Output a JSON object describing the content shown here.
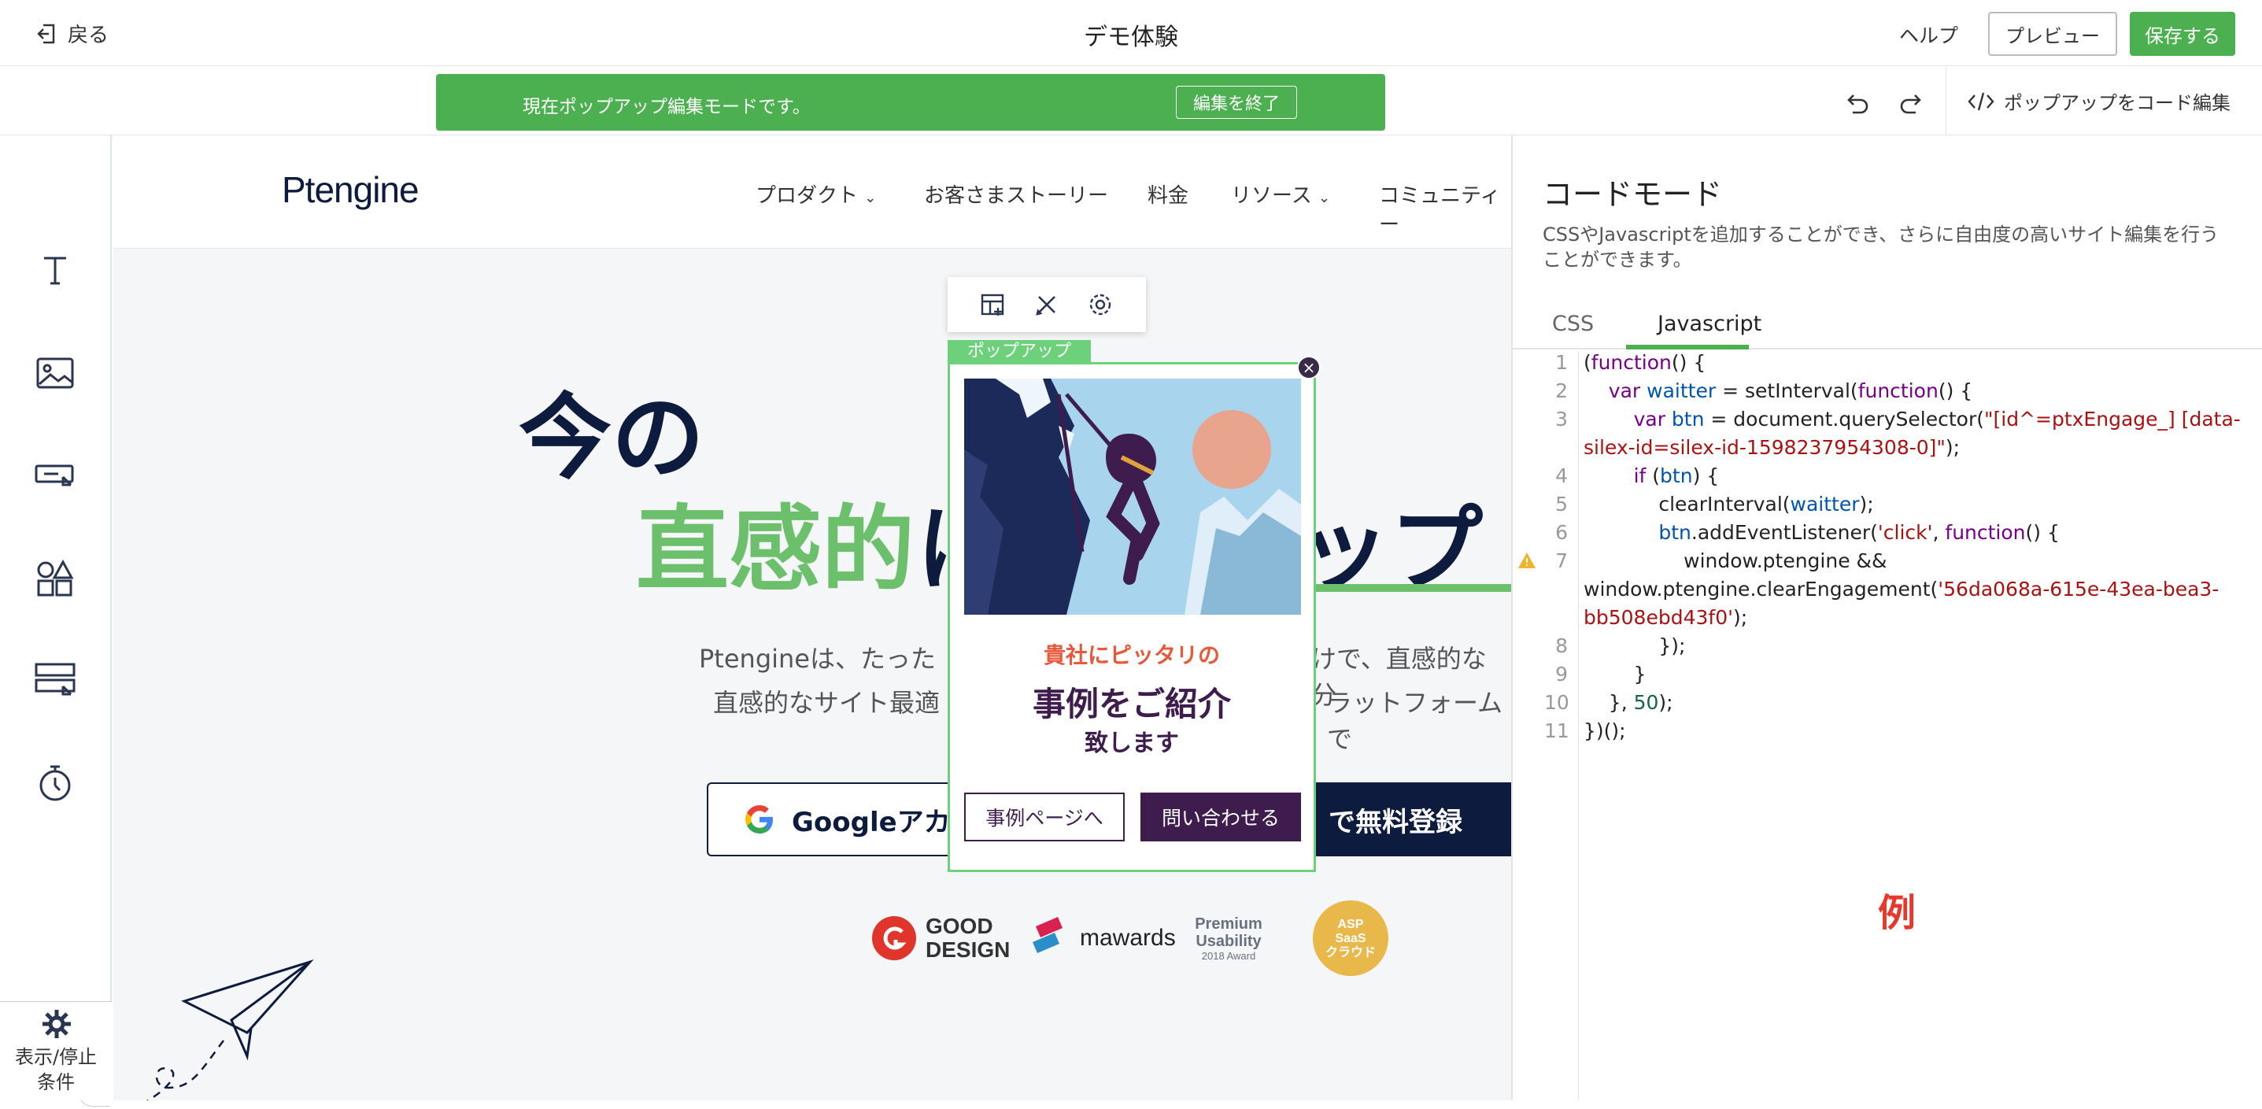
{
  "topbar": {
    "back_label": "戻る",
    "title": "デモ体験",
    "help": "ヘルプ",
    "preview": "プレビュー",
    "save": "保存する"
  },
  "subbar": {
    "banner_text": "現在ポップアップ編集モードです。",
    "exit_label": "編集を終了",
    "code_edit_label": "ポップアップをコード編集"
  },
  "left_toolbar": {
    "condition_label_1": "表示/停止",
    "condition_label_2": "条件"
  },
  "site": {
    "logo": "Ptengine",
    "nav": [
      "プロダクト",
      "お客さまストーリー",
      "料金",
      "リソース",
      "コミュニティー"
    ],
    "hero_line1": "今の　　　用を",
    "hero_line2_green": "直感的",
    "hero_line2_dark": "に",
    "hero_line2_end": "ップ",
    "desc_line1_a": "Ptengineは、たった",
    "desc_line1_b": "けで、直感的な分",
    "desc_line2_a": "直感的なサイト最適",
    "desc_line2_b": "ラットフォームで",
    "google_btn": "Googleアカウ",
    "register_btn": "で無料登録",
    "awards": {
      "good_design_1": "GOOD",
      "good_design_2": "DESIGN",
      "mawards": "mawards",
      "premium_1": "Premium",
      "premium_2": "Usability",
      "premium_3": "2018 Award",
      "asp_1": "ASP",
      "asp_2": "SaaS",
      "asp_3": "クラウド"
    }
  },
  "popup": {
    "tag": "ポップアップ",
    "subtitle": "貴社にピッタリの",
    "title": "事例をご紹介",
    "title2": "致します",
    "btn_case": "事例ページへ",
    "btn_contact": "問い合わせる"
  },
  "code_panel": {
    "title": "コードモード",
    "description": "CSSやJavascriptを追加することができ、さらに自由度の高いサイト編集を行うことができます。",
    "tabs": [
      "CSS",
      "Javascript"
    ],
    "active_tab": "Javascript",
    "line_numbers": [
      "1",
      "2",
      "3",
      "4",
      "5",
      "6",
      "7",
      "8",
      "9",
      "10",
      "11"
    ],
    "example_label": "例",
    "code": {
      "l1a": "(",
      "l1b": "function",
      "l1c": "() {",
      "l2a": "    ",
      "l2b": "var",
      "l2c": " waitter",
      "l2d": " = setInterval(",
      "l2e": "function",
      "l2f": "() {",
      "l3a": "        ",
      "l3b": "var",
      "l3c": " btn",
      "l3d": " = document.querySelector(",
      "l3e": "\"[id^=ptxEngage_] [data-",
      "l3f": "silex-id=silex-id-1598237954308-0]\"",
      "l3g": ");",
      "l4a": "        ",
      "l4b": "if",
      "l4c": " (",
      "l4d": "btn",
      "l4e": ") {",
      "l5a": "            clearInterval(",
      "l5b": "waitter",
      "l5c": ");",
      "l6a": "            ",
      "l6b": "btn",
      "l6c": ".addEventListener(",
      "l6d": "'click'",
      "l6e": ", ",
      "l6f": "function",
      "l6g": "() {",
      "l7a": "                window.ptengine &&",
      "l7b": "window.ptengine.clearEngagement(",
      "l7c": "'56da068a-615e-43ea-bea3-",
      "l7d": "bb508ebd43f0'",
      "l7e": ");",
      "l8": "            });",
      "l9": "        }",
      "l10a": "    }, ",
      "l10b": "50",
      "l10c": ");",
      "l11": "})();"
    }
  },
  "colors": {
    "accent_green": "#4caf50",
    "navy": "#0d1b3e",
    "popup_purple": "#3e1c4d",
    "popup_orange": "#e8583a"
  }
}
